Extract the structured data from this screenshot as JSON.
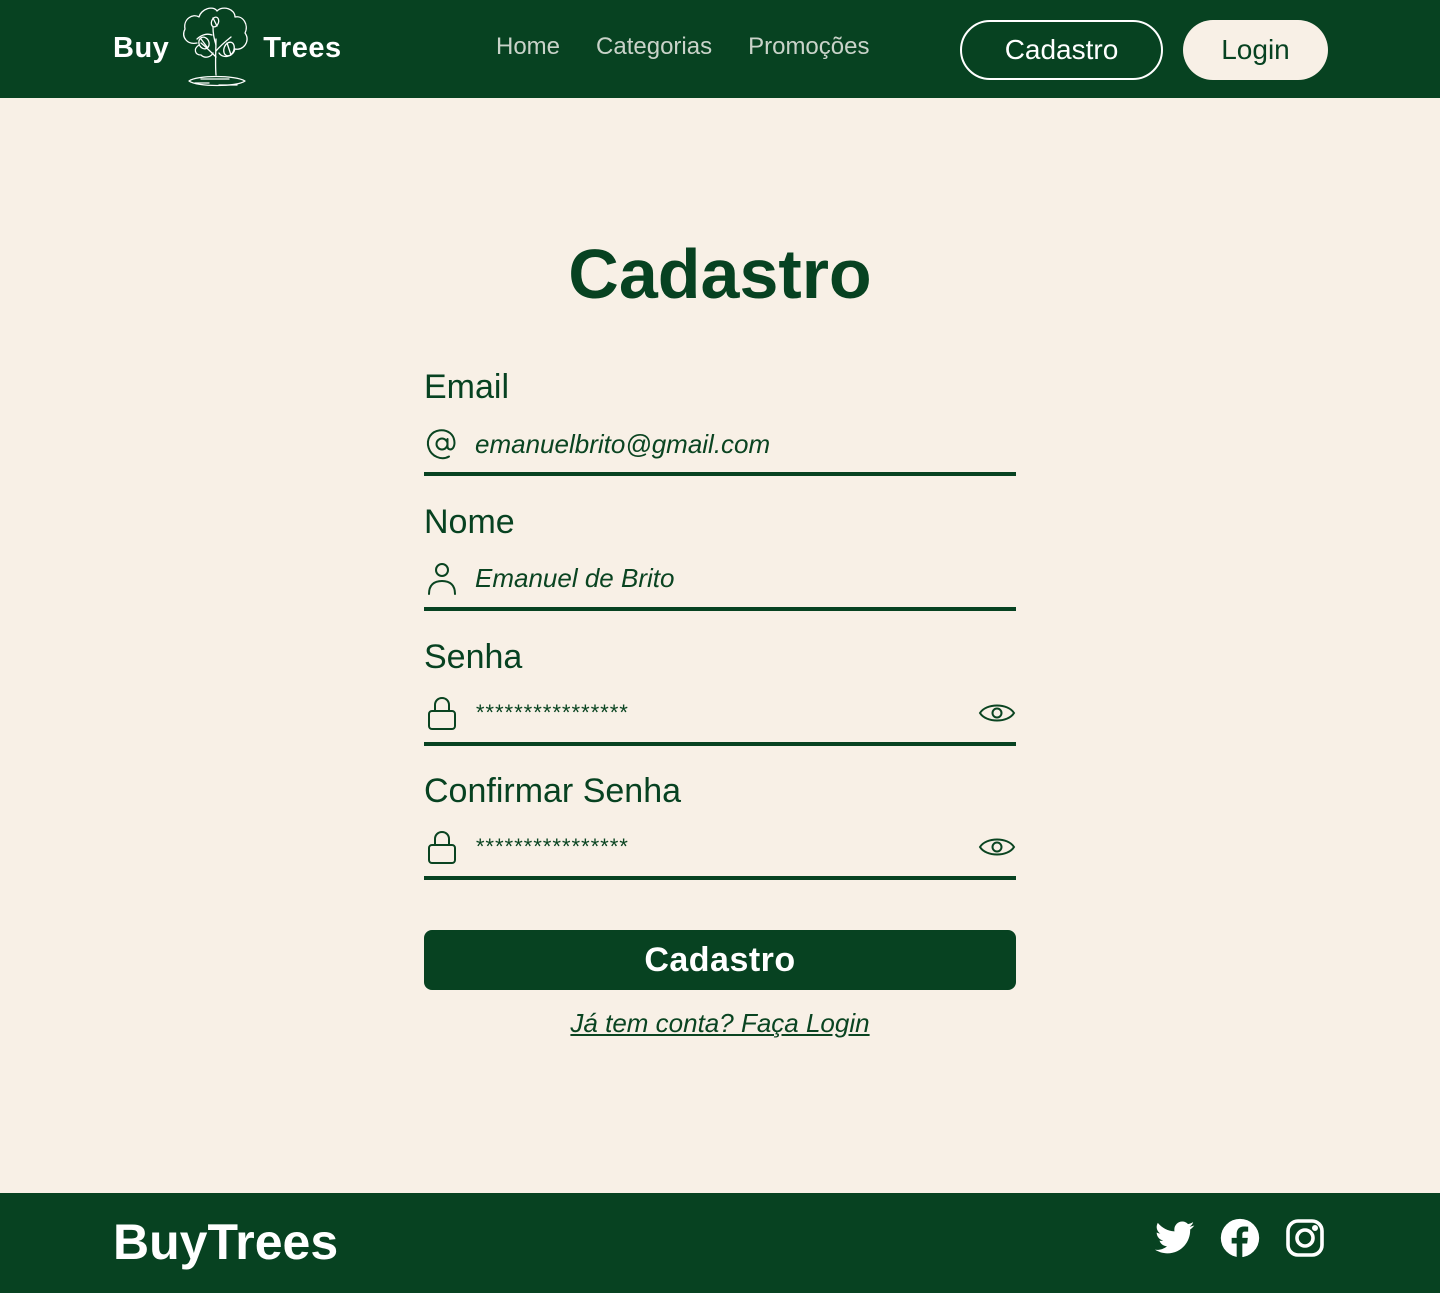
{
  "header": {
    "logo_left": "Buy",
    "logo_right": "Trees",
    "nav": [
      "Home",
      "Categorias",
      "Promoções"
    ],
    "signup_button": "Cadastro",
    "login_button": "Login"
  },
  "main": {
    "title": "Cadastro",
    "fields": {
      "email": {
        "label": "Email",
        "value": "emanuelbrito@gmail.com",
        "icon": "at-icon"
      },
      "name": {
        "label": "Nome",
        "value": "Emanuel de Brito",
        "icon": "user-icon"
      },
      "password": {
        "label": "Senha",
        "value": "****************",
        "icon": "lock-icon",
        "toggle_icon": "eye-icon"
      },
      "confirm_password": {
        "label": "Confirmar Senha",
        "value": "****************",
        "icon": "lock-icon",
        "toggle_icon": "eye-icon"
      }
    },
    "submit_button": "Cadastro",
    "login_link": "Já tem conta? Faça Login"
  },
  "footer": {
    "brand": "BuyTrees",
    "social": [
      "twitter-icon",
      "facebook-icon",
      "instagram-icon"
    ]
  },
  "colors": {
    "primary": "#074221",
    "background": "#f8f0e6",
    "nav_text": "#c9d3c9",
    "white": "#ffffff"
  }
}
